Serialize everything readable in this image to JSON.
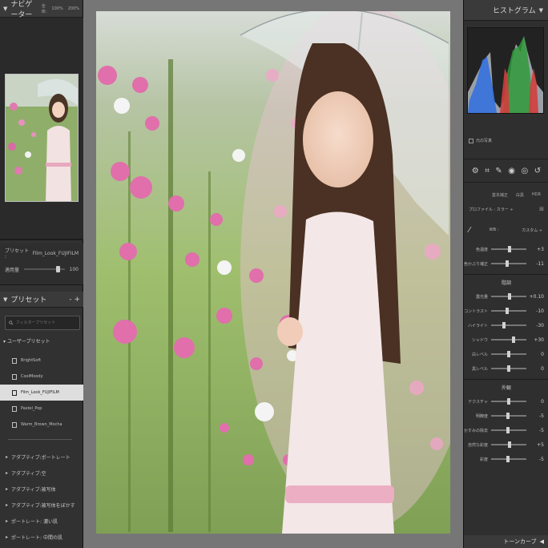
{
  "navigator": {
    "title": "ナビゲーター",
    "zoom_options": [
      "全体:",
      "100%",
      "200%"
    ]
  },
  "preset_amount": {
    "label_prefix": "プリセット :",
    "preset_name": "Film_Look_FUJIFILM",
    "amount_label": "適用量",
    "amount_value": "100",
    "amount_fraction": 1.0
  },
  "presets_panel": {
    "title": "プリセット",
    "controls": "-  +",
    "search_placeholder": "フィルタープリセット",
    "user_group": "ユーザープリセット",
    "items": [
      {
        "name": "BrightSoft",
        "selected": false
      },
      {
        "name": "CoolMoody",
        "selected": false
      },
      {
        "name": "Film_Look_FUJIFILM",
        "selected": true
      },
      {
        "name": "Pastel_Pop",
        "selected": false
      },
      {
        "name": "Warm_Brown_Mocha",
        "selected": false
      }
    ],
    "groups": [
      "アダプティブ:ポートレート",
      "アダプティブ:空",
      "アダプティブ:被写体",
      "アダプティブ:被写体をぼかす",
      "ポートレート: 濃い肌",
      "ポートレート: 中間の肌"
    ]
  },
  "histogram": {
    "title": "ヒストグラム",
    "original_photo_label": "元の写真"
  },
  "basic_panel": {
    "tabs": [
      "基本補正",
      "白黒",
      "HDR"
    ],
    "profile_label": "プロファイル : カラー ÷",
    "wb_label": "WB :",
    "wb_value": "カスタム ÷",
    "tone_label": "階調",
    "presence_label": "外観",
    "sliders_wb": [
      {
        "label": "色温度",
        "value": "+3",
        "pos": 0.53
      },
      {
        "label": "色かぶり補正",
        "value": "-11",
        "pos": 0.45
      }
    ],
    "sliders_tone": [
      {
        "label": "露光量",
        "value": "+0.10",
        "pos": 0.52
      },
      {
        "label": "コントラスト",
        "value": "-10",
        "pos": 0.45
      },
      {
        "label": "ハイライト",
        "value": "-30",
        "pos": 0.35
      },
      {
        "label": "シャドウ",
        "value": "+30",
        "pos": 0.65
      },
      {
        "label": "白レベル",
        "value": "0",
        "pos": 0.5
      },
      {
        "label": "黒レベル",
        "value": "0",
        "pos": 0.5
      }
    ],
    "sliders_presence": [
      {
        "label": "テクスチャ",
        "value": "0",
        "pos": 0.5
      },
      {
        "label": "明瞭度",
        "value": "-5",
        "pos": 0.47
      },
      {
        "label": "かすみの除去",
        "value": "-5",
        "pos": 0.47
      },
      {
        "label": "自然な彩度",
        "value": "+5",
        "pos": 0.53
      },
      {
        "label": "彩度",
        "value": "-5",
        "pos": 0.47
      }
    ]
  },
  "tone_curve_label": "トーンカーブ"
}
